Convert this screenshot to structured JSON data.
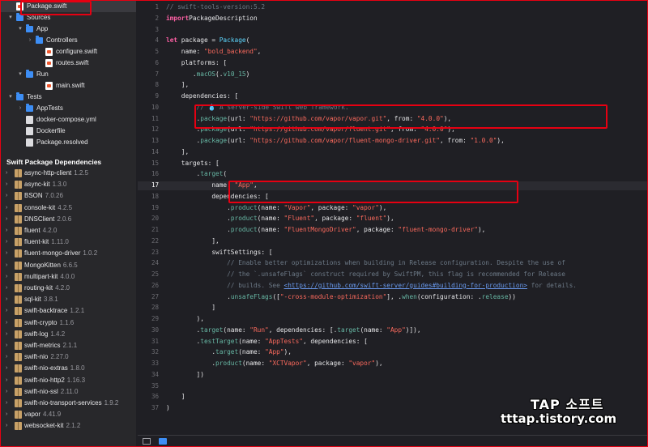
{
  "navigator": {
    "files": [
      {
        "label": "Package.swift",
        "kind": "swift",
        "depth": 0,
        "chev": ""
      },
      {
        "label": "Sources",
        "kind": "folder",
        "depth": 0,
        "chev": "▾"
      },
      {
        "label": "App",
        "kind": "folder",
        "depth": 1,
        "chev": "▾"
      },
      {
        "label": "Controllers",
        "kind": "folder",
        "depth": 2,
        "chev": "›"
      },
      {
        "label": "configure.swift",
        "kind": "swift",
        "depth": 3,
        "chev": ""
      },
      {
        "label": "routes.swift",
        "kind": "swift",
        "depth": 3,
        "chev": ""
      },
      {
        "label": "Run",
        "kind": "folder",
        "depth": 1,
        "chev": "▾"
      },
      {
        "label": "main.swift",
        "kind": "swift",
        "depth": 3,
        "chev": ""
      },
      {
        "label": "Tests",
        "kind": "folder",
        "depth": 0,
        "chev": "▾"
      },
      {
        "label": "AppTests",
        "kind": "folder",
        "depth": 1,
        "chev": "›"
      },
      {
        "label": "docker-compose.yml",
        "kind": "file",
        "depth": 1,
        "chev": ""
      },
      {
        "label": "Dockerfile",
        "kind": "file",
        "depth": 1,
        "chev": ""
      },
      {
        "label": "Package.resolved",
        "kind": "file",
        "depth": 1,
        "chev": ""
      }
    ],
    "deps_title": "Swift Package Dependencies",
    "dependencies": [
      {
        "name": "async-http-client",
        "version": "1.2.5"
      },
      {
        "name": "async-kit",
        "version": "1.3.0"
      },
      {
        "name": "BSON",
        "version": "7.0.26"
      },
      {
        "name": "console-kit",
        "version": "4.2.5"
      },
      {
        "name": "DNSClient",
        "version": "2.0.6"
      },
      {
        "name": "fluent",
        "version": "4.2.0"
      },
      {
        "name": "fluent-kit",
        "version": "1.11.0"
      },
      {
        "name": "fluent-mongo-driver",
        "version": "1.0.2"
      },
      {
        "name": "MongoKitten",
        "version": "6.6.5"
      },
      {
        "name": "multipart-kit",
        "version": "4.0.0"
      },
      {
        "name": "routing-kit",
        "version": "4.2.0"
      },
      {
        "name": "sql-kit",
        "version": "3.8.1"
      },
      {
        "name": "swift-backtrace",
        "version": "1.2.1"
      },
      {
        "name": "swift-crypto",
        "version": "1.1.6"
      },
      {
        "name": "swift-log",
        "version": "1.4.2"
      },
      {
        "name": "swift-metrics",
        "version": "2.1.1"
      },
      {
        "name": "swift-nio",
        "version": "2.27.0"
      },
      {
        "name": "swift-nio-extras",
        "version": "1.8.0"
      },
      {
        "name": "swift-nio-http2",
        "version": "1.16.3"
      },
      {
        "name": "swift-nio-ssl",
        "version": "2.11.0"
      },
      {
        "name": "swift-nio-transport-services",
        "version": "1.9.2"
      },
      {
        "name": "vapor",
        "version": "4.41.9"
      },
      {
        "name": "websocket-kit",
        "version": "2.1.2"
      }
    ]
  },
  "editor": {
    "current_line": 17,
    "lines": [
      [
        [
          "cmt",
          "// swift-tools-version:5.2"
        ]
      ],
      [
        [
          "kw",
          "import"
        ],
        [
          "",
          "PackageDescription"
        ]
      ],
      [
        [
          "",
          ""
        ]
      ],
      [
        [
          "kw",
          "let"
        ],
        [
          "",
          " package = "
        ],
        [
          "typ",
          "Package"
        ],
        [
          "",
          "("
        ]
      ],
      [
        [
          "",
          "    name: "
        ],
        [
          "str",
          "\"bold_backend\""
        ],
        [
          "",
          ","
        ]
      ],
      [
        [
          "",
          "    platforms: ["
        ]
      ],
      [
        [
          "",
          "       ."
        ],
        [
          "fn",
          "macOS"
        ],
        [
          "",
          "(."
        ],
        [
          "fn",
          "v10_15"
        ],
        [
          "",
          ")"
        ]
      ],
      [
        [
          "",
          "    ],"
        ]
      ],
      [
        [
          "",
          "    dependencies: ["
        ]
      ],
      [
        [
          "cmt",
          "        // "
        ],
        [
          "emoji",
          "💧"
        ],
        [
          "cmt",
          " A server-side Swift web framework."
        ]
      ],
      [
        [
          "",
          "        ."
        ],
        [
          "fn",
          "package"
        ],
        [
          "",
          "(url: "
        ],
        [
          "str",
          "\"https://github.com/vapor/vapor.git\""
        ],
        [
          "",
          ", from: "
        ],
        [
          "str",
          "\"4.0.0\""
        ],
        [
          "",
          "),"
        ]
      ],
      [
        [
          "",
          "        ."
        ],
        [
          "fn",
          "package"
        ],
        [
          "",
          "(url: "
        ],
        [
          "str",
          "\"https://github.com/vapor/fluent.git\""
        ],
        [
          "",
          ", from: "
        ],
        [
          "str",
          "\"4.0.0\""
        ],
        [
          "",
          "),"
        ]
      ],
      [
        [
          "",
          "        ."
        ],
        [
          "fn",
          "package"
        ],
        [
          "",
          "(url: "
        ],
        [
          "str",
          "\"https://github.com/vapor/fluent-mongo-driver.git\""
        ],
        [
          "",
          ", from: "
        ],
        [
          "str",
          "\"1.0.0\""
        ],
        [
          "",
          "),"
        ]
      ],
      [
        [
          "",
          "    ],"
        ]
      ],
      [
        [
          "",
          "    targets: ["
        ]
      ],
      [
        [
          "",
          "        ."
        ],
        [
          "fn",
          "target"
        ],
        [
          "",
          "("
        ]
      ],
      [
        [
          "",
          "            name: "
        ],
        [
          "str",
          "\"App\""
        ],
        [
          "",
          ","
        ]
      ],
      [
        [
          "",
          "            dependencies: ["
        ]
      ],
      [
        [
          "",
          "                ."
        ],
        [
          "fn",
          "product"
        ],
        [
          "",
          "(name: "
        ],
        [
          "str",
          "\"Vapor\""
        ],
        [
          "",
          ", package: "
        ],
        [
          "str",
          "\"vapor\""
        ],
        [
          "",
          "),"
        ]
      ],
      [
        [
          "",
          "                ."
        ],
        [
          "fn",
          "product"
        ],
        [
          "",
          "(name: "
        ],
        [
          "str",
          "\"Fluent\""
        ],
        [
          "",
          ", package: "
        ],
        [
          "str",
          "\"fluent\""
        ],
        [
          "",
          "),"
        ]
      ],
      [
        [
          "",
          "                ."
        ],
        [
          "fn",
          "product"
        ],
        [
          "",
          "(name: "
        ],
        [
          "str",
          "\"FluentMongoDriver\""
        ],
        [
          "",
          ", package: "
        ],
        [
          "str",
          "\"fluent-mongo-driver\""
        ],
        [
          "",
          "),"
        ]
      ],
      [
        [
          "",
          "            ],"
        ]
      ],
      [
        [
          "",
          "            swiftSettings: ["
        ]
      ],
      [
        [
          "cmt",
          "                // Enable better optimizations when building in Release configuration. Despite the use of"
        ]
      ],
      [
        [
          "cmt",
          "                // the `.unsafeFlags` construct required by SwiftPM, this flag is recommended for Release"
        ]
      ],
      [
        [
          "cmt",
          "                // builds. See "
        ],
        [
          "lnk",
          "<https://github.com/swift-server/guides#building-for-production>"
        ],
        [
          "cmt",
          " for details."
        ]
      ],
      [
        [
          "",
          "                ."
        ],
        [
          "fn",
          "unsafeFlags"
        ],
        [
          "",
          "(["
        ],
        [
          "str",
          "\"-cross-module-optimization\""
        ],
        [
          "",
          "], ."
        ],
        [
          "fn",
          "when"
        ],
        [
          "",
          "(configuration: ."
        ],
        [
          "fn",
          "release"
        ],
        [
          "",
          "))"
        ]
      ],
      [
        [
          "",
          "            ]"
        ]
      ],
      [
        [
          "",
          "        ),"
        ]
      ],
      [
        [
          "",
          "        ."
        ],
        [
          "fn",
          "target"
        ],
        [
          "",
          "(name: "
        ],
        [
          "str",
          "\"Run\""
        ],
        [
          "",
          ", dependencies: [."
        ],
        [
          "fn",
          "target"
        ],
        [
          "",
          "(name: "
        ],
        [
          "str",
          "\"App\""
        ],
        [
          "",
          ")]),"
        ]
      ],
      [
        [
          "",
          "        ."
        ],
        [
          "fn",
          "testTarget"
        ],
        [
          "",
          "(name: "
        ],
        [
          "str",
          "\"AppTests\""
        ],
        [
          "",
          ", dependencies: ["
        ]
      ],
      [
        [
          "",
          "            ."
        ],
        [
          "fn",
          "target"
        ],
        [
          "",
          "(name: "
        ],
        [
          "str",
          "\"App\""
        ],
        [
          "",
          "),"
        ]
      ],
      [
        [
          "",
          "            ."
        ],
        [
          "fn",
          "product"
        ],
        [
          "",
          "(name: "
        ],
        [
          "str",
          "\"XCTVapor\""
        ],
        [
          "",
          ", package: "
        ],
        [
          "str",
          "\"vapor\""
        ],
        [
          "",
          "),"
        ]
      ],
      [
        [
          "",
          "        ])"
        ]
      ],
      [
        [
          "",
          ""
        ]
      ],
      [
        [
          "",
          "    ]"
        ]
      ],
      [
        [
          "",
          ")"
        ]
      ]
    ]
  },
  "watermark": {
    "title": "TAP 소프트",
    "url": "tttap.tistory.com"
  },
  "colors": {
    "highlight_border": "#e60012",
    "background": "#1f1f24",
    "sidebar": "#28282b"
  }
}
